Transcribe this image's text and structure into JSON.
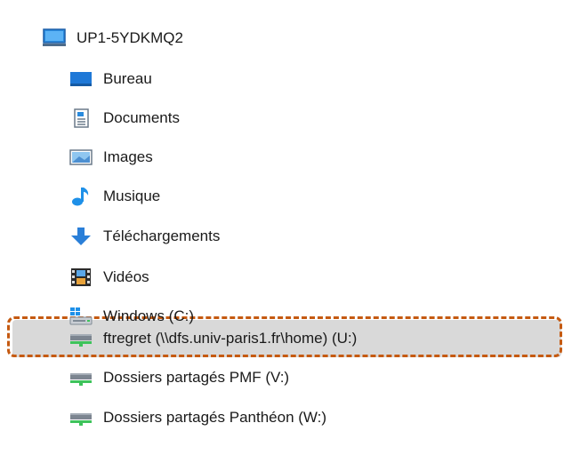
{
  "tree": {
    "root": {
      "label": "UP1-5YDKMQ2",
      "icon": "computer-icon"
    },
    "items": [
      {
        "label": "Bureau",
        "icon": "desktop-folder-icon"
      },
      {
        "label": "Documents",
        "icon": "documents-folder-icon"
      },
      {
        "label": "Images",
        "icon": "images-folder-icon"
      },
      {
        "label": "Musique",
        "icon": "music-note-icon"
      },
      {
        "label": "Téléchargements",
        "icon": "download-arrow-icon"
      },
      {
        "label": "Vidéos",
        "icon": "video-film-icon"
      },
      {
        "label": "Windows (C:)",
        "icon": "windows-drive-icon"
      },
      {
        "label": "ftregret (\\\\dfs.univ-paris1.fr\\home) (U:)",
        "icon": "network-drive-icon",
        "selected": true
      },
      {
        "label": "Dossiers partagés PMF (V:)",
        "icon": "network-drive-icon"
      },
      {
        "label": "Dossiers partagés Panthéon (W:)",
        "icon": "network-drive-icon"
      }
    ]
  },
  "colors": {
    "selection": "#d9d9d9",
    "highlight_dash": "#c55a11",
    "folder_blue": "#1e78d7"
  }
}
